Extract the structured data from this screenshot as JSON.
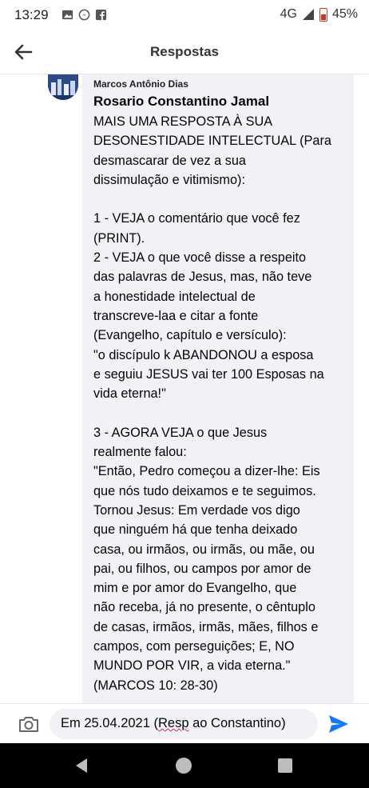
{
  "status_bar": {
    "time": "13:29",
    "network": "4G",
    "battery": "45%"
  },
  "header": {
    "title": "Respostas"
  },
  "comment": {
    "author": "Marcos Antônio Dias",
    "mention": "Rosario Constantino Jamal",
    "lines": [
      "MAIS UMA RESPOSTA À SUA",
      "DESONESTIDADE INTELECTUAL (Para",
      "desmascarar de vez a sua",
      "dissimulação e vitimismo):",
      "",
      "1 - VEJA o comentário que você fez",
      "(PRINT).",
      "2 -  VEJA o que você disse a respeito",
      "das palavras de Jesus, mas, não teve",
      "a honestidade intelectual de",
      "transcreve-laa e citar a fonte",
      "(Evangelho, capítulo e versículo):",
      "\"o discípulo k ABANDONOU  a esposa",
      "e seguiu JESUS vai ter 100 Esposas na",
      "vida eterna!\"",
      "",
      "3 - AGORA VEJA o que Jesus",
      "realmente falou:",
      "\"Então, Pedro começou a dizer-lhe: Eis",
      "que nós tudo deixamos e te seguimos.",
      "Tornou Jesus: Em verdade vos digo",
      "que ninguém há que tenha deixado",
      "casa, ou irmãos, ou irmãs, ou mãe, ou",
      "pai, ou filhos, ou campos por amor de",
      "mim e por amor do Evangelho, que",
      "não receba, já no presente, o cêntuplo",
      "de casas, irmãos, irmãs, mães, filhos e",
      "campos, com perseguições; E, NO",
      "MUNDO POR VIR, a vida eterna.\"",
      "(MARCOS 10: 28-30)"
    ]
  },
  "composer": {
    "text_before": "Em 25.04.2021 (",
    "text_misspelled": "Resp",
    "text_after": " ao Constantino)"
  },
  "colors": {
    "accent": "#1877f2",
    "bubble": "#f0f2f5",
    "nav_bar": "#000000"
  },
  "icons": {
    "back": "arrow-left-icon",
    "camera": "camera-icon",
    "send": "send-icon"
  }
}
